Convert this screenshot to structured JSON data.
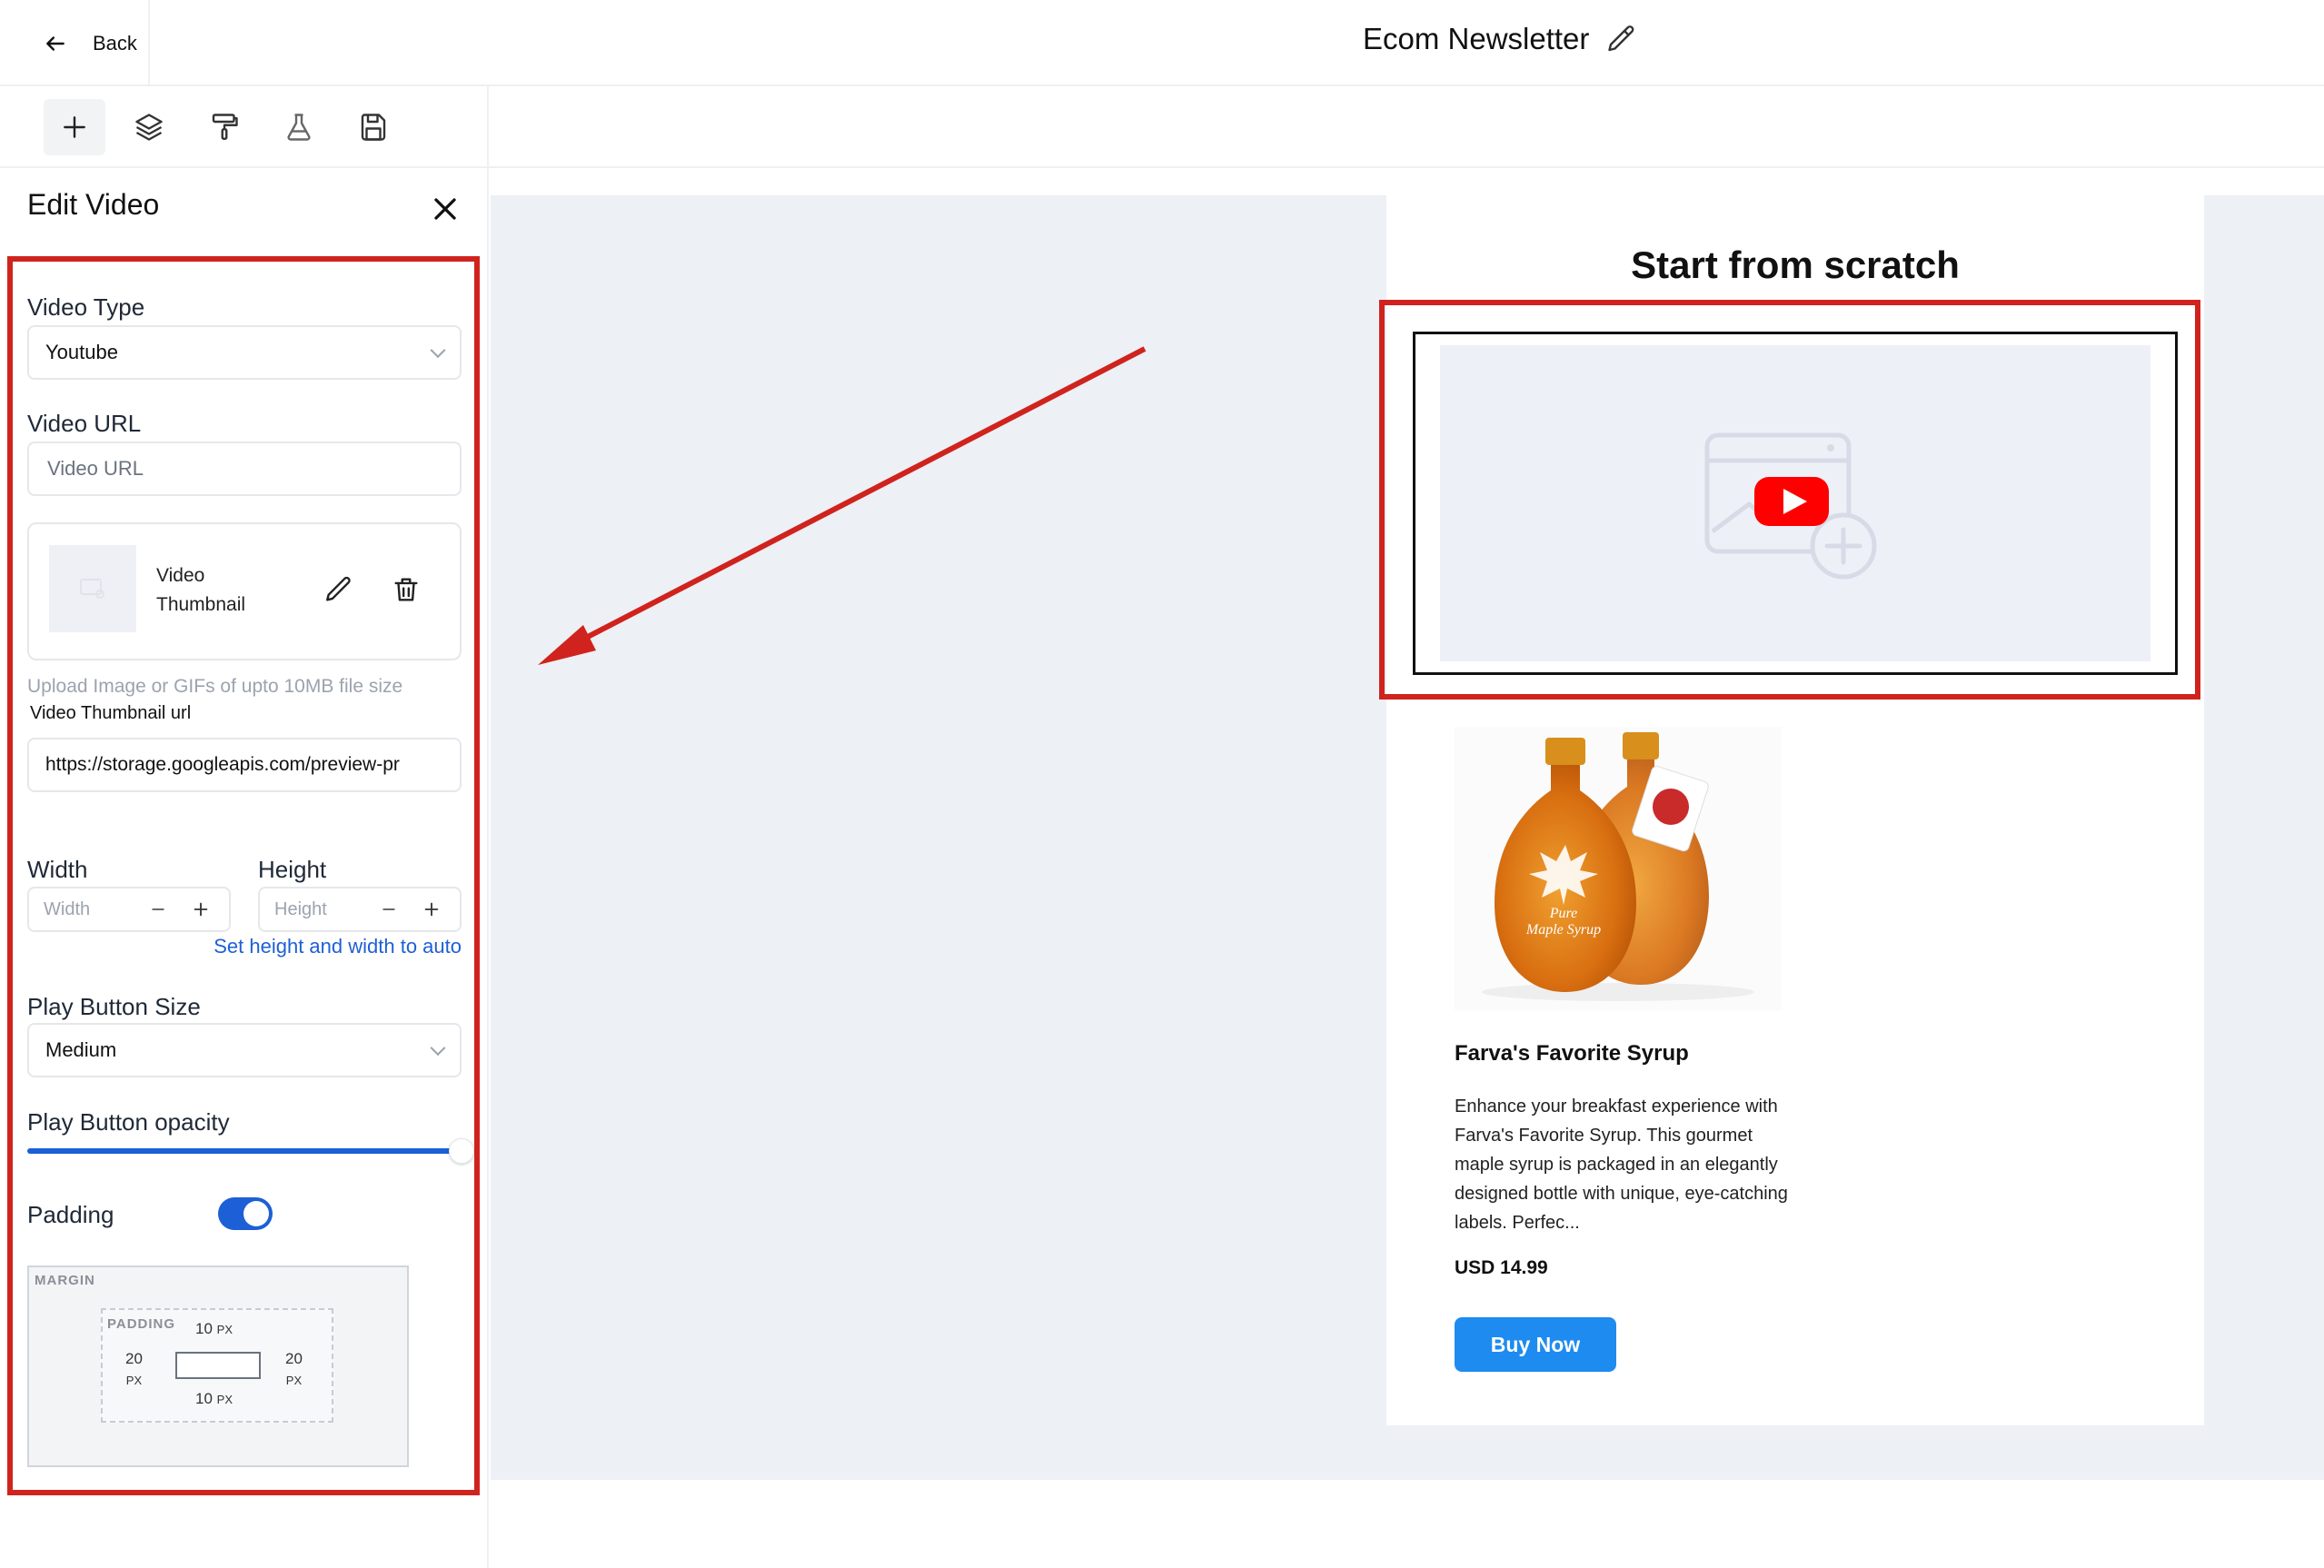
{
  "header": {
    "back_label": "Back",
    "doc_title": "Ecom Newsletter"
  },
  "toolbar": {
    "tools": [
      "plus-icon",
      "layers-icon",
      "paint-roller-icon",
      "flask-icon",
      "save-icon"
    ]
  },
  "panel": {
    "title": "Edit Video",
    "video_type_label": "Video Type",
    "video_type_value": "Youtube",
    "video_url_label": "Video URL",
    "video_url_placeholder": "Video URL",
    "thumbnail_label_1": "Video",
    "thumbnail_label_2": "Thumbnail",
    "upload_hint": "Upload Image or GIFs of upto 10MB file size",
    "thumb_url_label": "Video Thumbnail url",
    "thumb_url_value": "https://storage.googleapis.com/preview-pr",
    "width_label": "Width",
    "width_placeholder": "Width",
    "height_label": "Height",
    "height_placeholder": "Height",
    "auto_link": "Set height and width to auto",
    "play_size_label": "Play Button Size",
    "play_size_value": "Medium",
    "play_opacity_label": "Play Button opacity",
    "play_opacity_value": 1.0,
    "padding_label": "Padding",
    "padding_enabled": true,
    "box": {
      "margin_label": "MARGIN",
      "padding_label": "PADDING",
      "top": "10",
      "bottom": "10",
      "left": "20",
      "right": "20",
      "unit": "PX"
    }
  },
  "canvas": {
    "heading": "Start from scratch",
    "product": {
      "name": "Farva's Favorite Syrup",
      "description": "Enhance your breakfast experience with Farva's Favorite Syrup. This gourmet maple syrup is packaged in an elegantly designed bottle with unique, eye-catching labels. Perfec...",
      "price": "USD 14.99",
      "cta": "Buy Now",
      "bottle_label_line1": "Pure",
      "bottle_label_line2": "Maple Syrup"
    }
  },
  "colors": {
    "accent": "#1e8bf0",
    "annotation_red": "#d0231d",
    "toggle_blue": "#1d5fd6",
    "link_blue": "#1d5fd6"
  }
}
